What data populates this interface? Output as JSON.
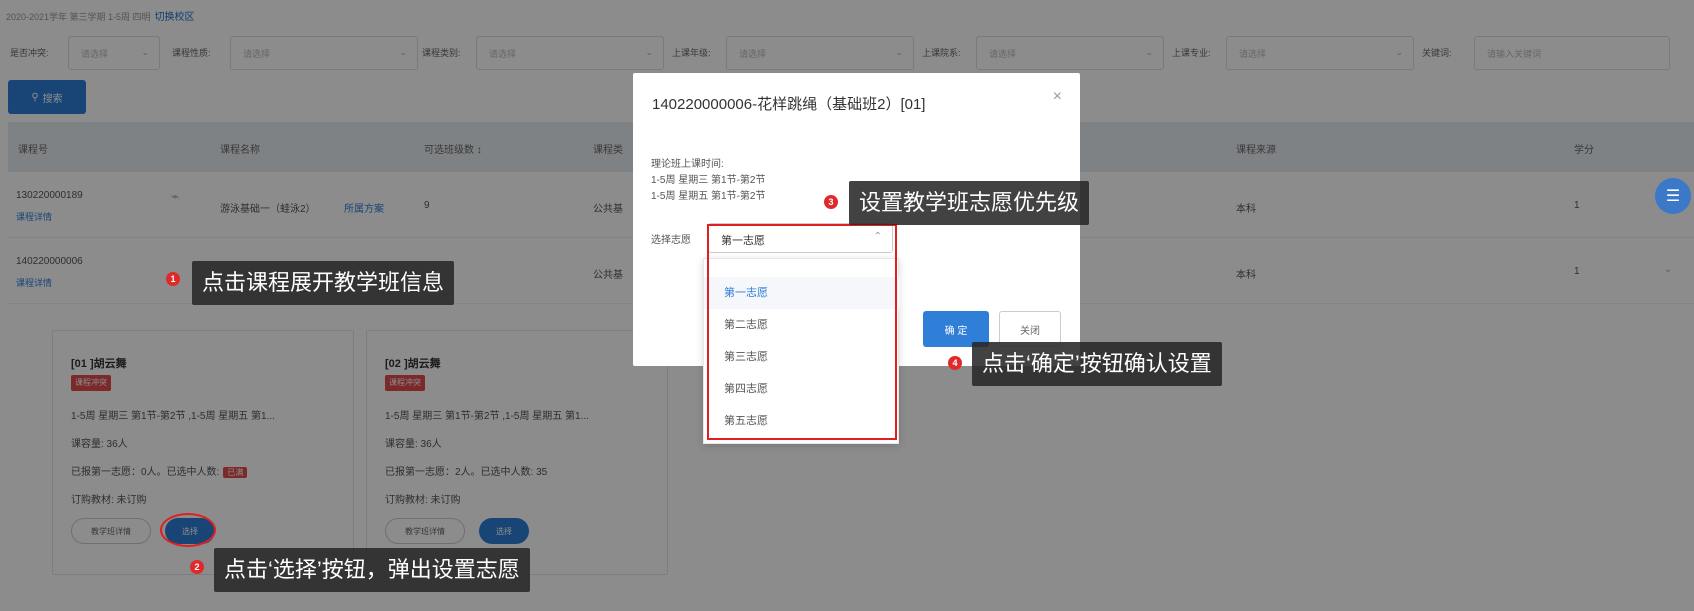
{
  "topline": {
    "text": "2020-2021学年 第三学期 1-5周 四明",
    "link": "切换校区"
  },
  "filters": {
    "conflict": {
      "label": "是否冲突:",
      "placeholder": "请选择"
    },
    "nature": {
      "label": "课程性质:",
      "placeholder": "请选择"
    },
    "category": {
      "label": "课程类别:",
      "placeholder": "请选择"
    },
    "grade": {
      "label": "上课年级:",
      "placeholder": "请选择"
    },
    "college": {
      "label": "上课院系:",
      "placeholder": "请选择"
    },
    "major": {
      "label": "上课专业:",
      "placeholder": "请选择"
    },
    "keyword": {
      "label": "关键词:",
      "placeholder": "请输入关键词"
    }
  },
  "search_label": "搜索",
  "table": {
    "headers": {
      "code": "课程号",
      "name": "课程名称",
      "classes": "可选班级数 ↕",
      "category": "课程类",
      "source": "课程来源",
      "credit": "学分"
    },
    "rows": [
      {
        "code": "130220000189",
        "detail": "课程详情",
        "name": "游泳基础一（蛙泳2）",
        "plan": "所属方案",
        "classes": "9",
        "category": "公共基",
        "source": "本科",
        "credit": "1"
      },
      {
        "code": "140220000006",
        "detail": "课程详情",
        "name": "",
        "plan": "",
        "classes": "",
        "category": "公共基",
        "source": "本科",
        "credit": "1"
      }
    ]
  },
  "cards": [
    {
      "title": "[01 ]胡云舞",
      "tag": "课程冲突",
      "time": "1-5周 星期三 第1节-第2节 ,1-5周 星期五 第1...",
      "capacity": "课容量: 36人",
      "status": "已报第一志愿：0人。已选中人数:",
      "badge": "已满",
      "books": "订购教材: 未订购",
      "detail_btn": "教学班详情",
      "select_btn": "选择"
    },
    {
      "title": "[02 ]胡云舞",
      "tag": "课程冲突",
      "time": "1-5周 星期三 第1节-第2节 ,1-5周 星期五 第1...",
      "capacity": "课容量: 36人",
      "status": "已报第一志愿：2人。已选中人数: 35",
      "badge": "",
      "books": "订购教材: 未订购",
      "detail_btn": "教学班详情",
      "select_btn": "选择"
    }
  ],
  "modal": {
    "title": "140220000006-花样跳绳（基础班2）[01]",
    "close": "×",
    "schedule_label": "理论班上课时间:",
    "schedule": [
      "1-5周 星期三 第1节-第2节",
      "1-5周 星期五 第1节-第2节"
    ],
    "select_label": "选择志愿",
    "selected": "第一志愿",
    "options": [
      "第一志愿",
      "第二志愿",
      "第三志愿",
      "第四志愿",
      "第五志愿"
    ],
    "ok": "确 定",
    "cancel": "关闭"
  },
  "callouts": [
    {
      "num": "1",
      "text": "点击课程展开教学班信息"
    },
    {
      "num": "2",
      "text": "点击‘选择’按钮，弹出设置志愿"
    },
    {
      "num": "3",
      "text": "设置教学班志愿优先级"
    },
    {
      "num": "4",
      "text": "点击‘确定’按钮确认设置"
    }
  ],
  "colors": {
    "primary": "#2f7ed8",
    "danger": "#e04b4b",
    "annotation": "#e02020"
  }
}
